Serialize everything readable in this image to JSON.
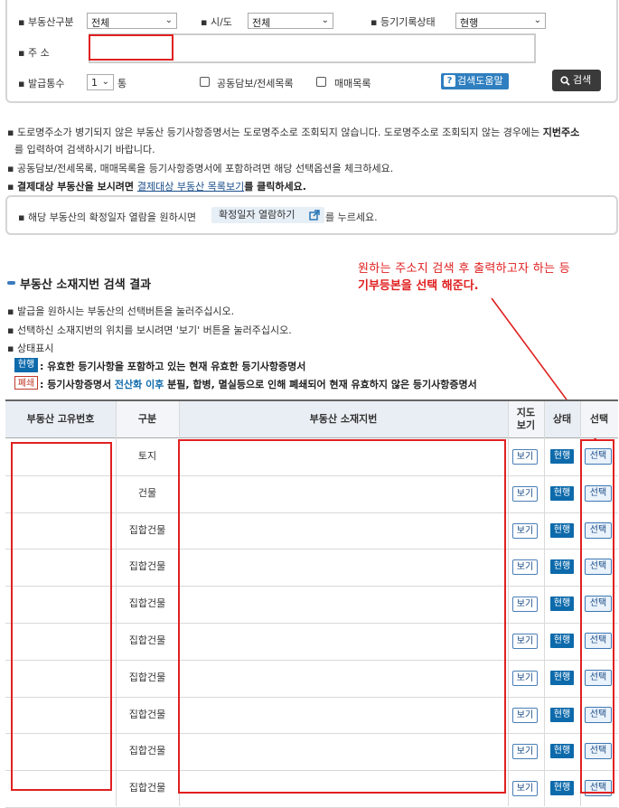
{
  "search": {
    "type_label": "부동산구분",
    "type_value": "전체",
    "region_label": "시/도",
    "region_value": "전체",
    "status_label": "등기기록상태",
    "status_value": "현행",
    "address_label": "주 소",
    "address_value": "",
    "count_label": "발급통수",
    "count_value": "1",
    "count_unit": "통",
    "option1_label": "공동담보/전세목록",
    "option2_label": "매매목록",
    "help_label": "검색도움말",
    "search_button": "검색"
  },
  "notices": {
    "n1a": "도로명주소가 병기되지 않은 부동산 등기사항증명서는 도로명주소로 조회되지 않습니다. 도로명주소로 조회되지 않는 경우에는 ",
    "n1b": "지번주소",
    "n1c": "를 입력하여 검색하시기 바랍니다.",
    "n2": "공동담보/전세목록, 매매목록을 등기사항증명서에 포함하려면 해당 선택옵션을 체크하세요.",
    "n3a": "결제대상 부동산을 보시려면 ",
    "n3link": "결제대상 부동산 목록보기",
    "n3b": "를 클릭하세요.",
    "n4a": "해당 부동산의 확정일자 열람을 원하시면 ",
    "n4btn": "확정일자 열람하기",
    "n4b": " 를 누르세요."
  },
  "annotation": {
    "line1": "원하는 주소지 검색 후 출력하고자 하는 등",
    "line2": "기부등본을 선택 해준다."
  },
  "results": {
    "title": "부동산 소재지번 검색 결과",
    "guide1": "발급을 원하시는 부동산의 선택버튼을 눌러주십시오.",
    "guide2": "선택하신 소재지번의 위치를 보시려면 '보기' 버튼을 눌러주십시오.",
    "guide3": "상태표시",
    "legend1_badge": "현행",
    "legend1_text": ": 유효한 등기사항을 포함하고 있는 현재 유효한 등기사항증명서",
    "legend2_badge": "폐쇄",
    "legend2_text_a": ": 등기사항증명서 ",
    "legend2_text_b": "전산화 이후",
    "legend2_text_c": " 분필, 합병, 멸실등으로 인해 폐쇄되어 현재 유효하지 않은 등기사항증명서",
    "col_id": "부동산 고유번호",
    "col_type": "구분",
    "col_addr": "부동산 소재지번",
    "col_map_1": "지도",
    "col_map_2": "보기",
    "col_status": "상태",
    "col_select": "선택",
    "view_label": "보기",
    "status_label": "현행",
    "select_label": "선택",
    "rows": [
      "토지",
      "건물",
      "집합건물",
      "집합건물",
      "집합건물",
      "집합건물",
      "집합건물",
      "집합건물",
      "집합건물",
      "집합건물"
    ]
  },
  "colors": {
    "badge_current": "#0d6aab",
    "badge_closed": "#c0392b",
    "annotation_red": "#e02020",
    "header_bg": "#e9eef4"
  }
}
